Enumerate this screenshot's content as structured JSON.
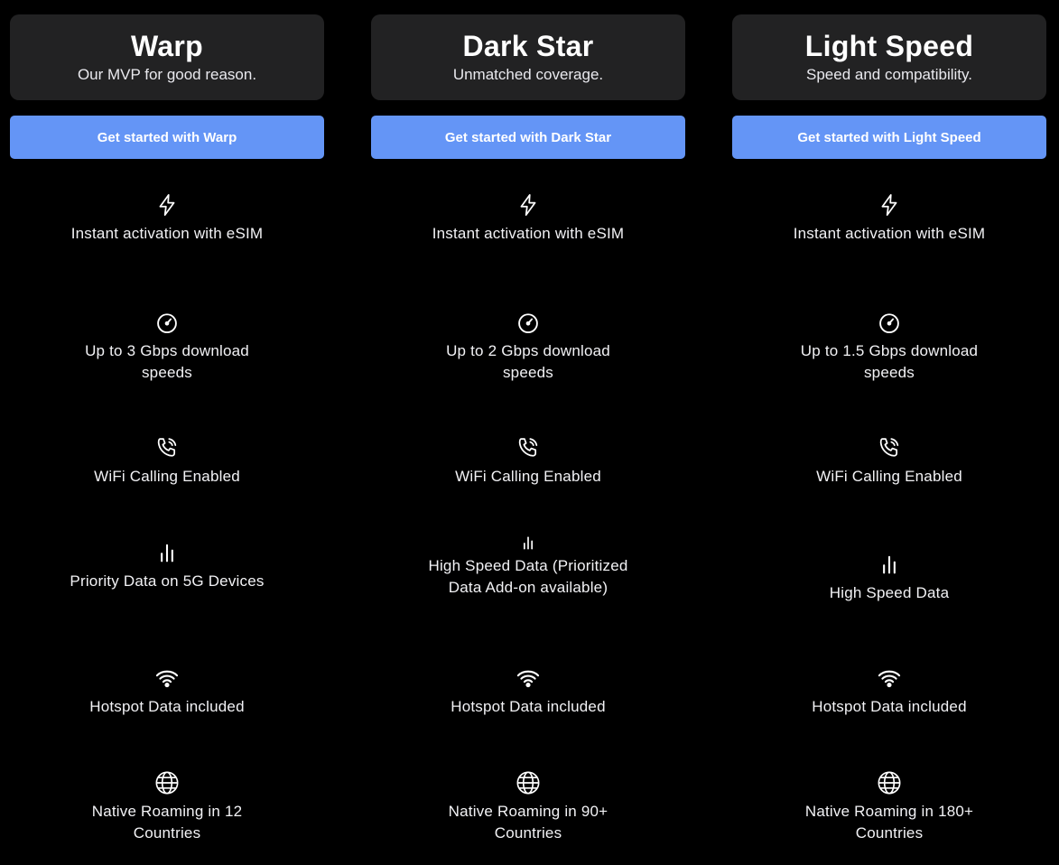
{
  "accent_color": "#6495f6",
  "plans": [
    {
      "name": "Warp",
      "tagline": "Our MVP for good reason.",
      "cta": "Get started with Warp",
      "features": [
        {
          "icon": "bolt-icon",
          "label": "Instant activation with eSIM"
        },
        {
          "icon": "speedometer-icon",
          "label": "Up to 3 Gbps download speeds"
        },
        {
          "icon": "wifi-calling-icon",
          "label": "WiFi Calling Enabled"
        },
        {
          "icon": "signal-bars-icon",
          "label": "Priority Data on 5G Devices"
        },
        {
          "icon": "hotspot-wifi-icon",
          "label": "Hotspot Data included"
        },
        {
          "icon": "globe-icon",
          "label": "Native Roaming in 12 Countries"
        }
      ]
    },
    {
      "name": "Dark Star",
      "tagline": "Unmatched coverage.",
      "cta": "Get started with Dark Star",
      "features": [
        {
          "icon": "bolt-icon",
          "label": "Instant activation with eSIM"
        },
        {
          "icon": "speedometer-icon",
          "label": "Up to 2 Gbps download speeds"
        },
        {
          "icon": "wifi-calling-icon",
          "label": "WiFi Calling Enabled"
        },
        {
          "icon": "signal-bars-icon",
          "label": "High Speed Data (Prioritized Data Add-on available)"
        },
        {
          "icon": "hotspot-wifi-icon",
          "label": "Hotspot Data included"
        },
        {
          "icon": "globe-icon",
          "label": "Native Roaming in 90+ Countries"
        }
      ]
    },
    {
      "name": "Light Speed",
      "tagline": "Speed and compatibility.",
      "cta": "Get started with Light Speed",
      "features": [
        {
          "icon": "bolt-icon",
          "label": "Instant activation with eSIM"
        },
        {
          "icon": "speedometer-icon",
          "label": "Up to 1.5 Gbps download speeds"
        },
        {
          "icon": "wifi-calling-icon",
          "label": "WiFi Calling Enabled"
        },
        {
          "icon": "signal-bars-icon",
          "label": "High Speed Data"
        },
        {
          "icon": "hotspot-wifi-icon",
          "label": "Hotspot Data included"
        },
        {
          "icon": "globe-icon",
          "label": "Native Roaming in 180+ Countries"
        }
      ]
    }
  ]
}
